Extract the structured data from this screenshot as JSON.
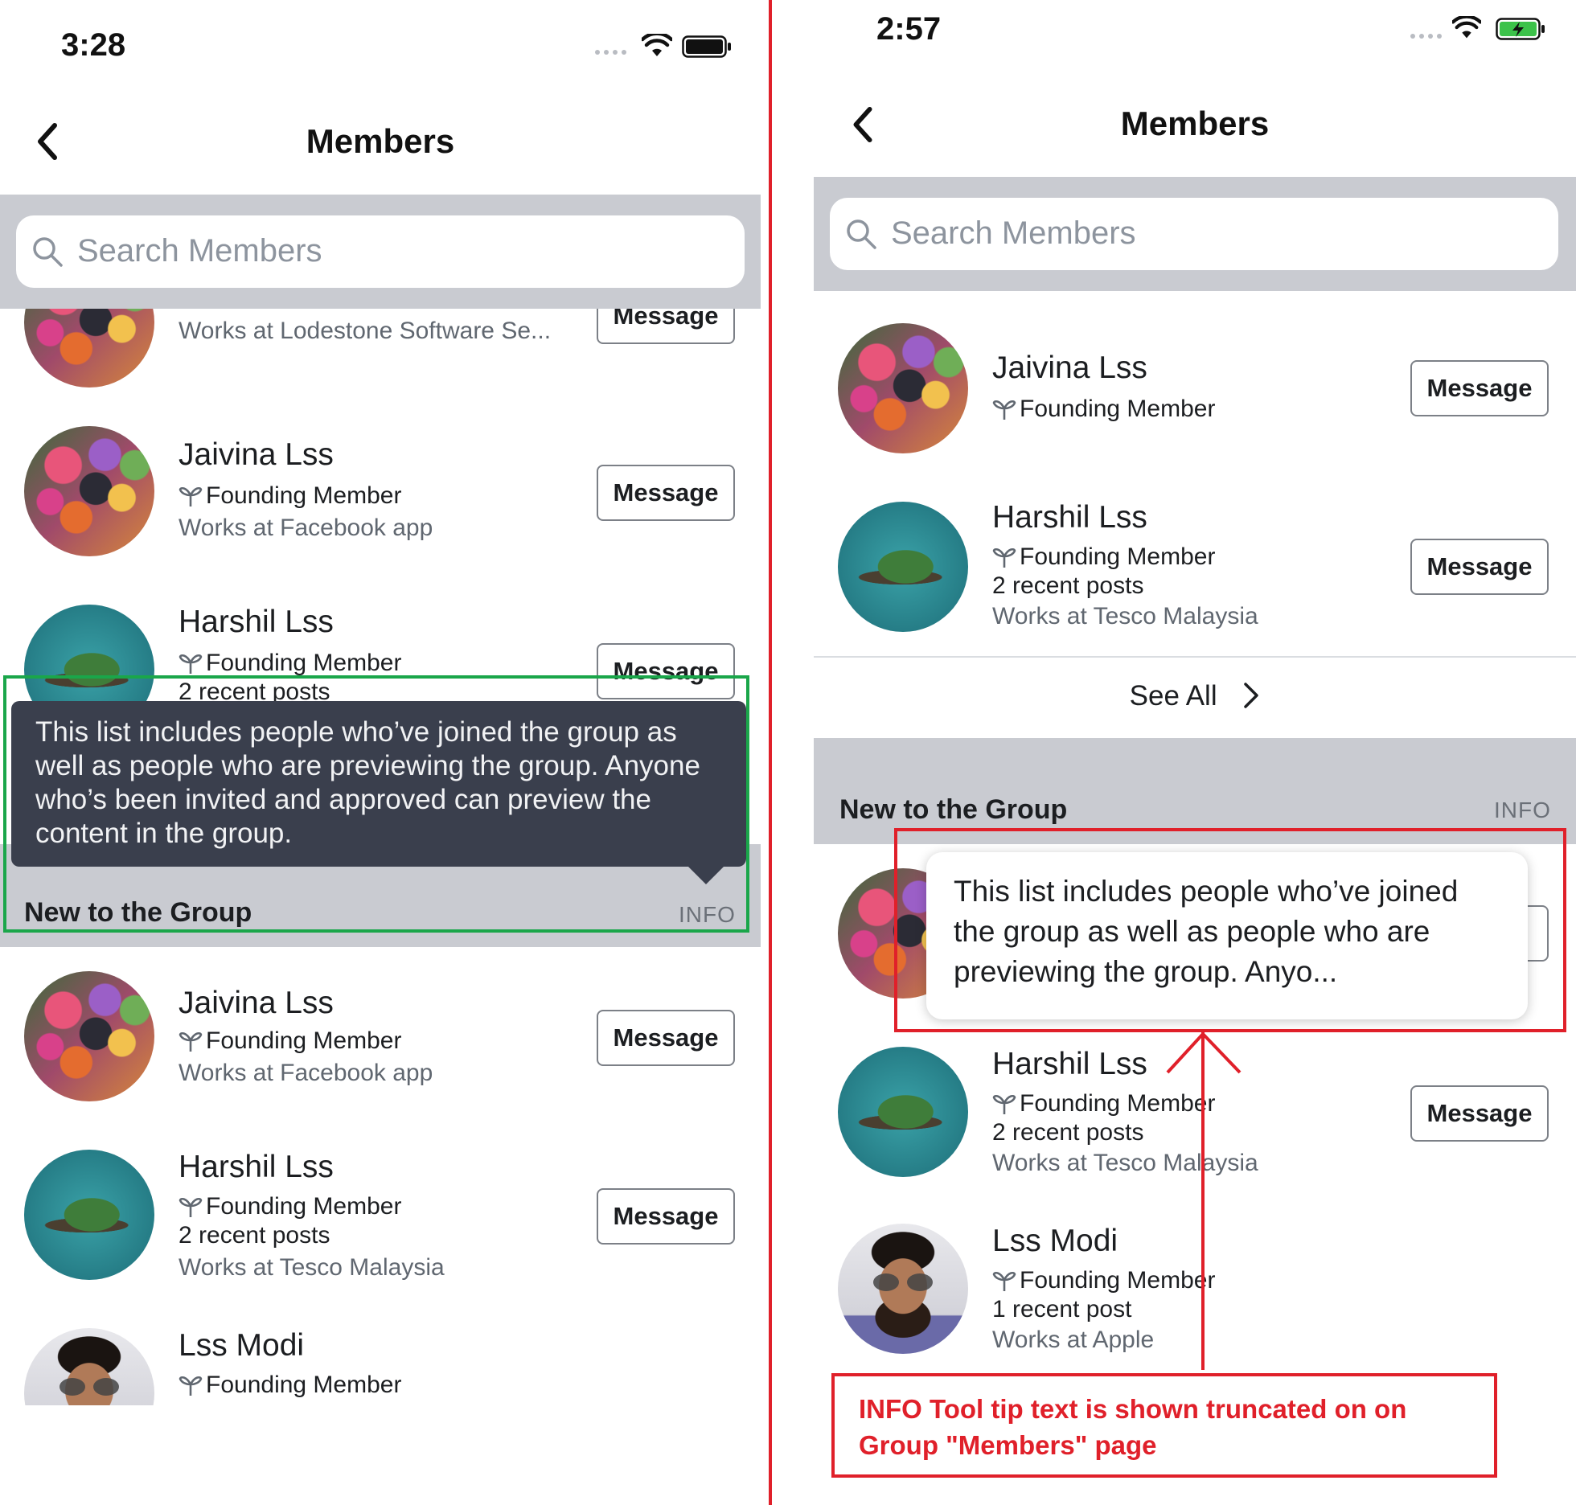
{
  "left": {
    "status_time": "3:28",
    "title": "Members",
    "search_placeholder": "Search Members",
    "partial_member": {
      "work": "Works at Lodestone Software Se...",
      "button": "Message"
    },
    "members_top": [
      {
        "name": "Jaivina Lss",
        "badge": "Founding Member",
        "work": "Works at Facebook app",
        "button": "Message",
        "avatar": "flowers"
      },
      {
        "name": "Harshil Lss",
        "badge": "Founding Member",
        "sub": "2 recent posts",
        "button": "Message",
        "avatar": "island"
      }
    ],
    "tooltip": "This list includes people who’ve joined the group as well as people who are previewing the group. Anyone who’s been invited and approved can preview the content in the group.",
    "section_title": "New to the Group",
    "section_info": "INFO",
    "members_new": [
      {
        "name": "Jaivina Lss",
        "badge": "Founding Member",
        "work": "Works at Facebook app",
        "button": "Message",
        "avatar": "flowers"
      },
      {
        "name": "Harshil Lss",
        "badge": "Founding Member",
        "sub": "2 recent posts",
        "work": "Works at Tesco Malaysia",
        "button": "Message",
        "avatar": "island"
      },
      {
        "name": "Lss Modi",
        "badge": "Founding Member",
        "avatar": "man"
      }
    ]
  },
  "right": {
    "status_time": "2:57",
    "title": "Members",
    "search_placeholder": "Search Members",
    "members_top": [
      {
        "name": "Jaivina Lss",
        "badge": "Founding Member",
        "button": "Message",
        "avatar": "flowers"
      },
      {
        "name": "Harshil Lss",
        "badge": "Founding Member",
        "sub": "2 recent posts",
        "work": "Works at Tesco Malaysia",
        "button": "Message",
        "avatar": "island"
      }
    ],
    "see_all": "See All",
    "section_title": "New to the Group",
    "section_info": "INFO",
    "tooltip": "This list includes people who’ve joined the group as well as people who are previewing the group. Anyo...",
    "members_new": [
      {
        "name": "Harshil Lss",
        "badge": "Founding Member",
        "sub": "2 recent posts",
        "work": "Works at Tesco Malaysia",
        "button": "Message",
        "avatar": "island"
      },
      {
        "name": "Lss Modi",
        "badge": "Founding Member",
        "sub": "1 recent post",
        "work": "Works at Apple",
        "avatar": "man"
      }
    ],
    "annotation": "INFO Tool tip text is shown truncated on on Group \"Members\" page"
  },
  "colors": {
    "highlight_green": "#1aa64a",
    "highlight_red": "#e0202a",
    "tooltip_dark": "#3a3f4d",
    "band_gray": "#c9cbd1"
  },
  "icons": [
    "back-chevron-icon",
    "search-icon",
    "wifi-icon",
    "battery-icon",
    "founding-member-icon",
    "chevron-right-icon"
  ]
}
